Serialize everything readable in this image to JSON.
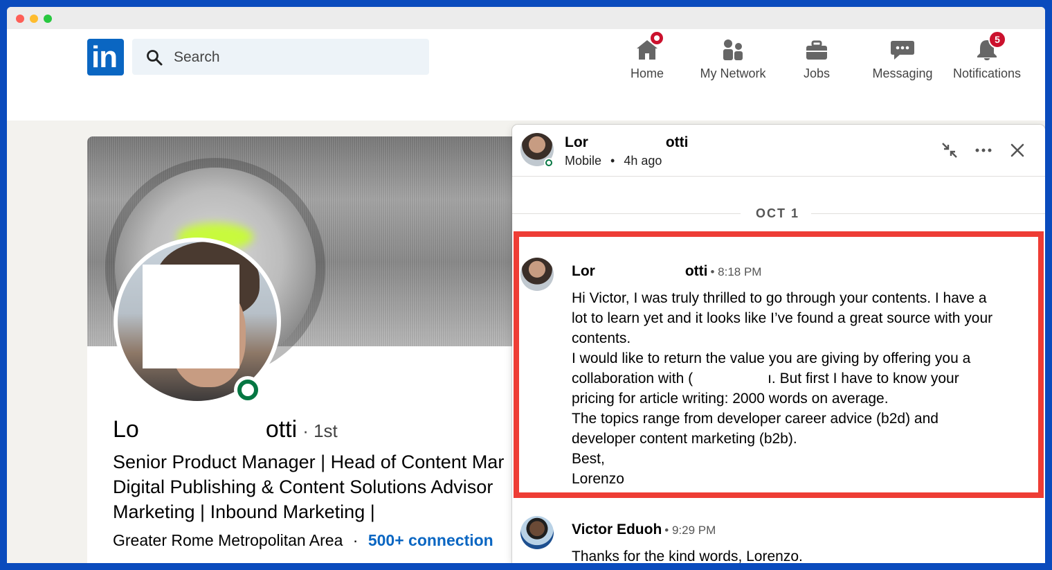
{
  "nav": {
    "search_placeholder": "Search",
    "items": [
      {
        "label": "Home",
        "icon": "home-icon",
        "badge": ""
      },
      {
        "label": "My Network",
        "icon": "network-icon",
        "badge": ""
      },
      {
        "label": "Jobs",
        "icon": "briefcase-icon",
        "badge": ""
      },
      {
        "label": "Messaging",
        "icon": "chat-icon",
        "badge": ""
      },
      {
        "label": "Notifications",
        "icon": "bell-icon",
        "badge": "5"
      }
    ],
    "colors": {
      "brand": "#0a66c2",
      "badge": "#cb112d"
    }
  },
  "profile": {
    "name_start": "Lo",
    "name_end": "otti",
    "degree": "· 1st",
    "headline_lines": [
      "Senior Product Manager | Head of Content Mar",
      "Digital Publishing & Content Solutions Advisor",
      "Marketing | Inbound Marketing |"
    ],
    "location": "Greater Rome Metropolitan Area",
    "separator": "·",
    "connections": "500+ connection"
  },
  "chat": {
    "header_name_start": "Lor",
    "header_name_end": "otti",
    "header_device": "Mobile",
    "header_dot": "•",
    "header_time": "4h ago",
    "date_divider": "OCT 1",
    "messages": [
      {
        "sender_start": "Lor",
        "sender_end": "otti",
        "time": "• 8:18 PM",
        "lines": [
          "Hi Victor, I was truly thrilled to go through your contents. I have a",
          "lot to learn yet and it looks like I’ve found a great source with your",
          "contents.",
          "I would like to return the value you are giving by offering you a"
        ],
        "collab_start": "collaboration with (",
        "collab_end": "ı. But first I have to know your",
        "lines_after": [
          "pricing for article writing: 2000 words on average.",
          "The topics range from developer career advice (b2d) and",
          "developer content marketing (b2b).",
          "Best,",
          "Lorenzo"
        ]
      },
      {
        "sender": "Victor Eduoh",
        "time": "• 9:29 PM",
        "lines": [
          "Thanks for the kind words, Lorenzo."
        ]
      }
    ],
    "highlight_color": "#ee3d35"
  }
}
